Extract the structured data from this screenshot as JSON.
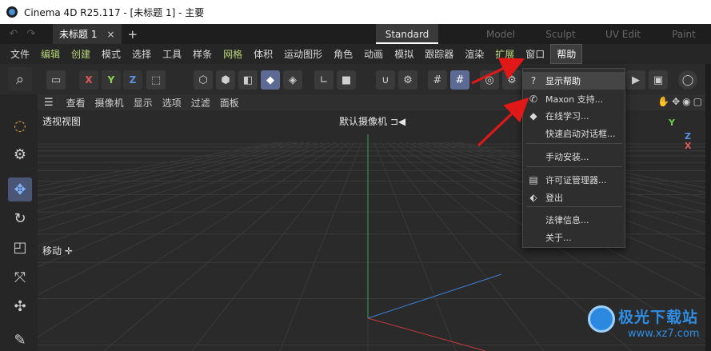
{
  "window": {
    "title": "Cinema 4D R25.117 - [未标题 1] - 主要"
  },
  "tabs": {
    "document_tab": "未标题 1",
    "close_glyph": "×",
    "add_glyph": "+",
    "layouts": [
      "Standard",
      "Model",
      "Sculpt",
      "UV Edit",
      "Paint"
    ],
    "active_layout": "Standard"
  },
  "menubar": {
    "items": [
      {
        "label": "文件",
        "style": "normal"
      },
      {
        "label": "编辑",
        "style": "green"
      },
      {
        "label": "创建",
        "style": "green"
      },
      {
        "label": "模式",
        "style": "normal"
      },
      {
        "label": "选择",
        "style": "normal"
      },
      {
        "label": "工具",
        "style": "normal"
      },
      {
        "label": "样条",
        "style": "normal"
      },
      {
        "label": "网格",
        "style": "green"
      },
      {
        "label": "体积",
        "style": "normal"
      },
      {
        "label": "运动图形",
        "style": "normal"
      },
      {
        "label": "角色",
        "style": "normal"
      },
      {
        "label": "动画",
        "style": "normal"
      },
      {
        "label": "模拟",
        "style": "normal"
      },
      {
        "label": "跟踪器",
        "style": "normal"
      },
      {
        "label": "渲染",
        "style": "normal"
      },
      {
        "label": "扩展",
        "style": "green"
      },
      {
        "label": "窗口",
        "style": "normal"
      },
      {
        "label": "帮助",
        "style": "active"
      }
    ]
  },
  "toolbar": {
    "axis_x": "X",
    "axis_y": "Y",
    "axis_z": "Z"
  },
  "viewport": {
    "menu": [
      "查看",
      "摄像机",
      "显示",
      "选项",
      "过滤",
      "面板"
    ],
    "view_name": "透视视图",
    "camera_name": "默认摄像机",
    "tool_hint": "移动",
    "axis_y": "Y",
    "axis_z": "Z",
    "axis_x": "X"
  },
  "help_menu": {
    "items": [
      {
        "label": "显示帮助",
        "icon": "question-icon",
        "glyph": "?",
        "highlighted": true
      },
      {
        "label": "Maxon 支持...",
        "icon": "phone-icon",
        "glyph": "✆",
        "highlighted": false
      },
      {
        "label": "在线学习...",
        "icon": "graduation-cap-icon",
        "glyph": "◆",
        "highlighted": false
      },
      {
        "label": "快速启动对话框...",
        "icon": "",
        "glyph": "",
        "highlighted": false
      },
      {
        "label": "手动安装...",
        "icon": "",
        "glyph": "",
        "highlighted": false
      },
      {
        "label": "许可证管理器...",
        "icon": "license-icon",
        "glyph": "▤",
        "highlighted": false
      },
      {
        "label": "登出",
        "icon": "logout-icon",
        "glyph": "⬖",
        "highlighted": false
      },
      {
        "label": "法律信息...",
        "icon": "",
        "glyph": "",
        "highlighted": false
      },
      {
        "label": "关于...",
        "icon": "",
        "glyph": "",
        "highlighted": false
      }
    ]
  },
  "watermark": {
    "main": "极光下载站",
    "sub": "www.xz7.com"
  },
  "colors": {
    "accent_green": "#b8d67a",
    "arrow_red": "#e01818",
    "axis_x": "#e25858",
    "axis_y": "#8cd158",
    "axis_z": "#5a8fe2",
    "selection": "#5d6a94"
  }
}
